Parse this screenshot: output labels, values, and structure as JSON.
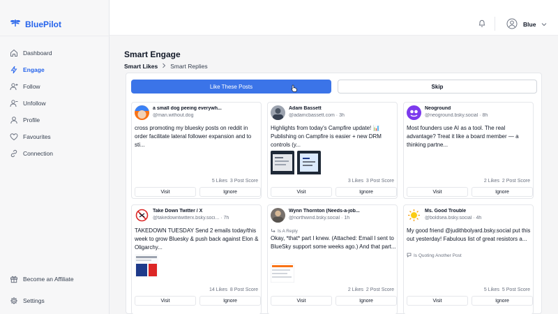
{
  "app": {
    "name": "BluePilot"
  },
  "sidebar": {
    "items": [
      {
        "label": "Dashboard",
        "icon": "home-icon",
        "active": false
      },
      {
        "label": "Engage",
        "icon": "lightning-icon",
        "active": true
      },
      {
        "label": "Follow",
        "icon": "user-plus-icon",
        "active": false
      },
      {
        "label": "Unfollow",
        "icon": "user-minus-icon",
        "active": false
      },
      {
        "label": "Profile",
        "icon": "user-icon",
        "active": false
      },
      {
        "label": "Favourites",
        "icon": "heart-icon",
        "active": false
      },
      {
        "label": "Connection",
        "icon": "link-icon",
        "active": false
      }
    ],
    "bottom": [
      {
        "label": "Become an Affiliate",
        "icon": "gift-icon"
      },
      {
        "label": "Settings",
        "icon": "gear-icon"
      }
    ]
  },
  "topbar": {
    "user_name": "Blue"
  },
  "page": {
    "title": "Smart Engage",
    "breadcrumb": [
      "Smart Likes",
      "Smart Replies"
    ],
    "like_button": "Like These Posts",
    "skip_button": "Skip"
  },
  "colors": {
    "accent": "#2563eb",
    "button": "#3b74e8"
  },
  "posts": [
    {
      "name": "a small dog peeing everywh...",
      "handle": "@man.without.dog",
      "text": "cross promoting my bluesky posts on reddit in order facilitate lateral follower expansion and to sti...",
      "likes": "5 Likes",
      "score": "3 Post Score",
      "visit": "Visit",
      "ignore": "Ignore"
    },
    {
      "name": "Adam Bassett",
      "handle": "@adamcbassett.com · 3h",
      "text": "Highlights from today's Campfire update! 📊 Publishing on Campfire is easier + new DRM controls (y...",
      "likes": "3 Likes",
      "score": "3 Post Score",
      "visit": "Visit",
      "ignore": "Ignore"
    },
    {
      "name": "Neoground",
      "handle": "@neoground.bsky.social · 8h",
      "text": "Most founders use AI as a tool. The real advantage? Treat it like a board member — a thinking partne...",
      "likes": "2 Likes",
      "score": "2 Post Score",
      "visit": "Visit",
      "ignore": "Ignore"
    },
    {
      "name": "Take Down Twitter / X",
      "handle": "@takedowntwitterx.bsky.soci... · 7h",
      "text": "TAKEDOWN TUESDAY Send 2 emails today/this week to grow Bluesky & push back against Elon & Oligarchy...",
      "likes": "14 Likes",
      "score": "8 Post Score",
      "visit": "Visit",
      "ignore": "Ignore"
    },
    {
      "name": "Wynn Thornton (Needs-a-job...",
      "handle": "@northwind.bsky.social · 1h",
      "tag": "Is A Reply",
      "text": "Okay, *that* part I knew. (Attached: Email I sent to BlueSky support some weeks ago.) And that part...",
      "likes": "2 Likes",
      "score": "2 Post Score",
      "visit": "Visit",
      "ignore": "Ignore"
    },
    {
      "name": "Ms. Good Trouble",
      "handle": "@boldsea.bsky.social · 4h",
      "tag": "Is Quoting Another Post",
      "text": "My good friend @judithbolyard.bsky.social put this out yesterday! Fabulous list of great resistors a...",
      "likes": "5 Likes",
      "score": "5 Post Score",
      "visit": "Visit",
      "ignore": "Ignore"
    }
  ]
}
